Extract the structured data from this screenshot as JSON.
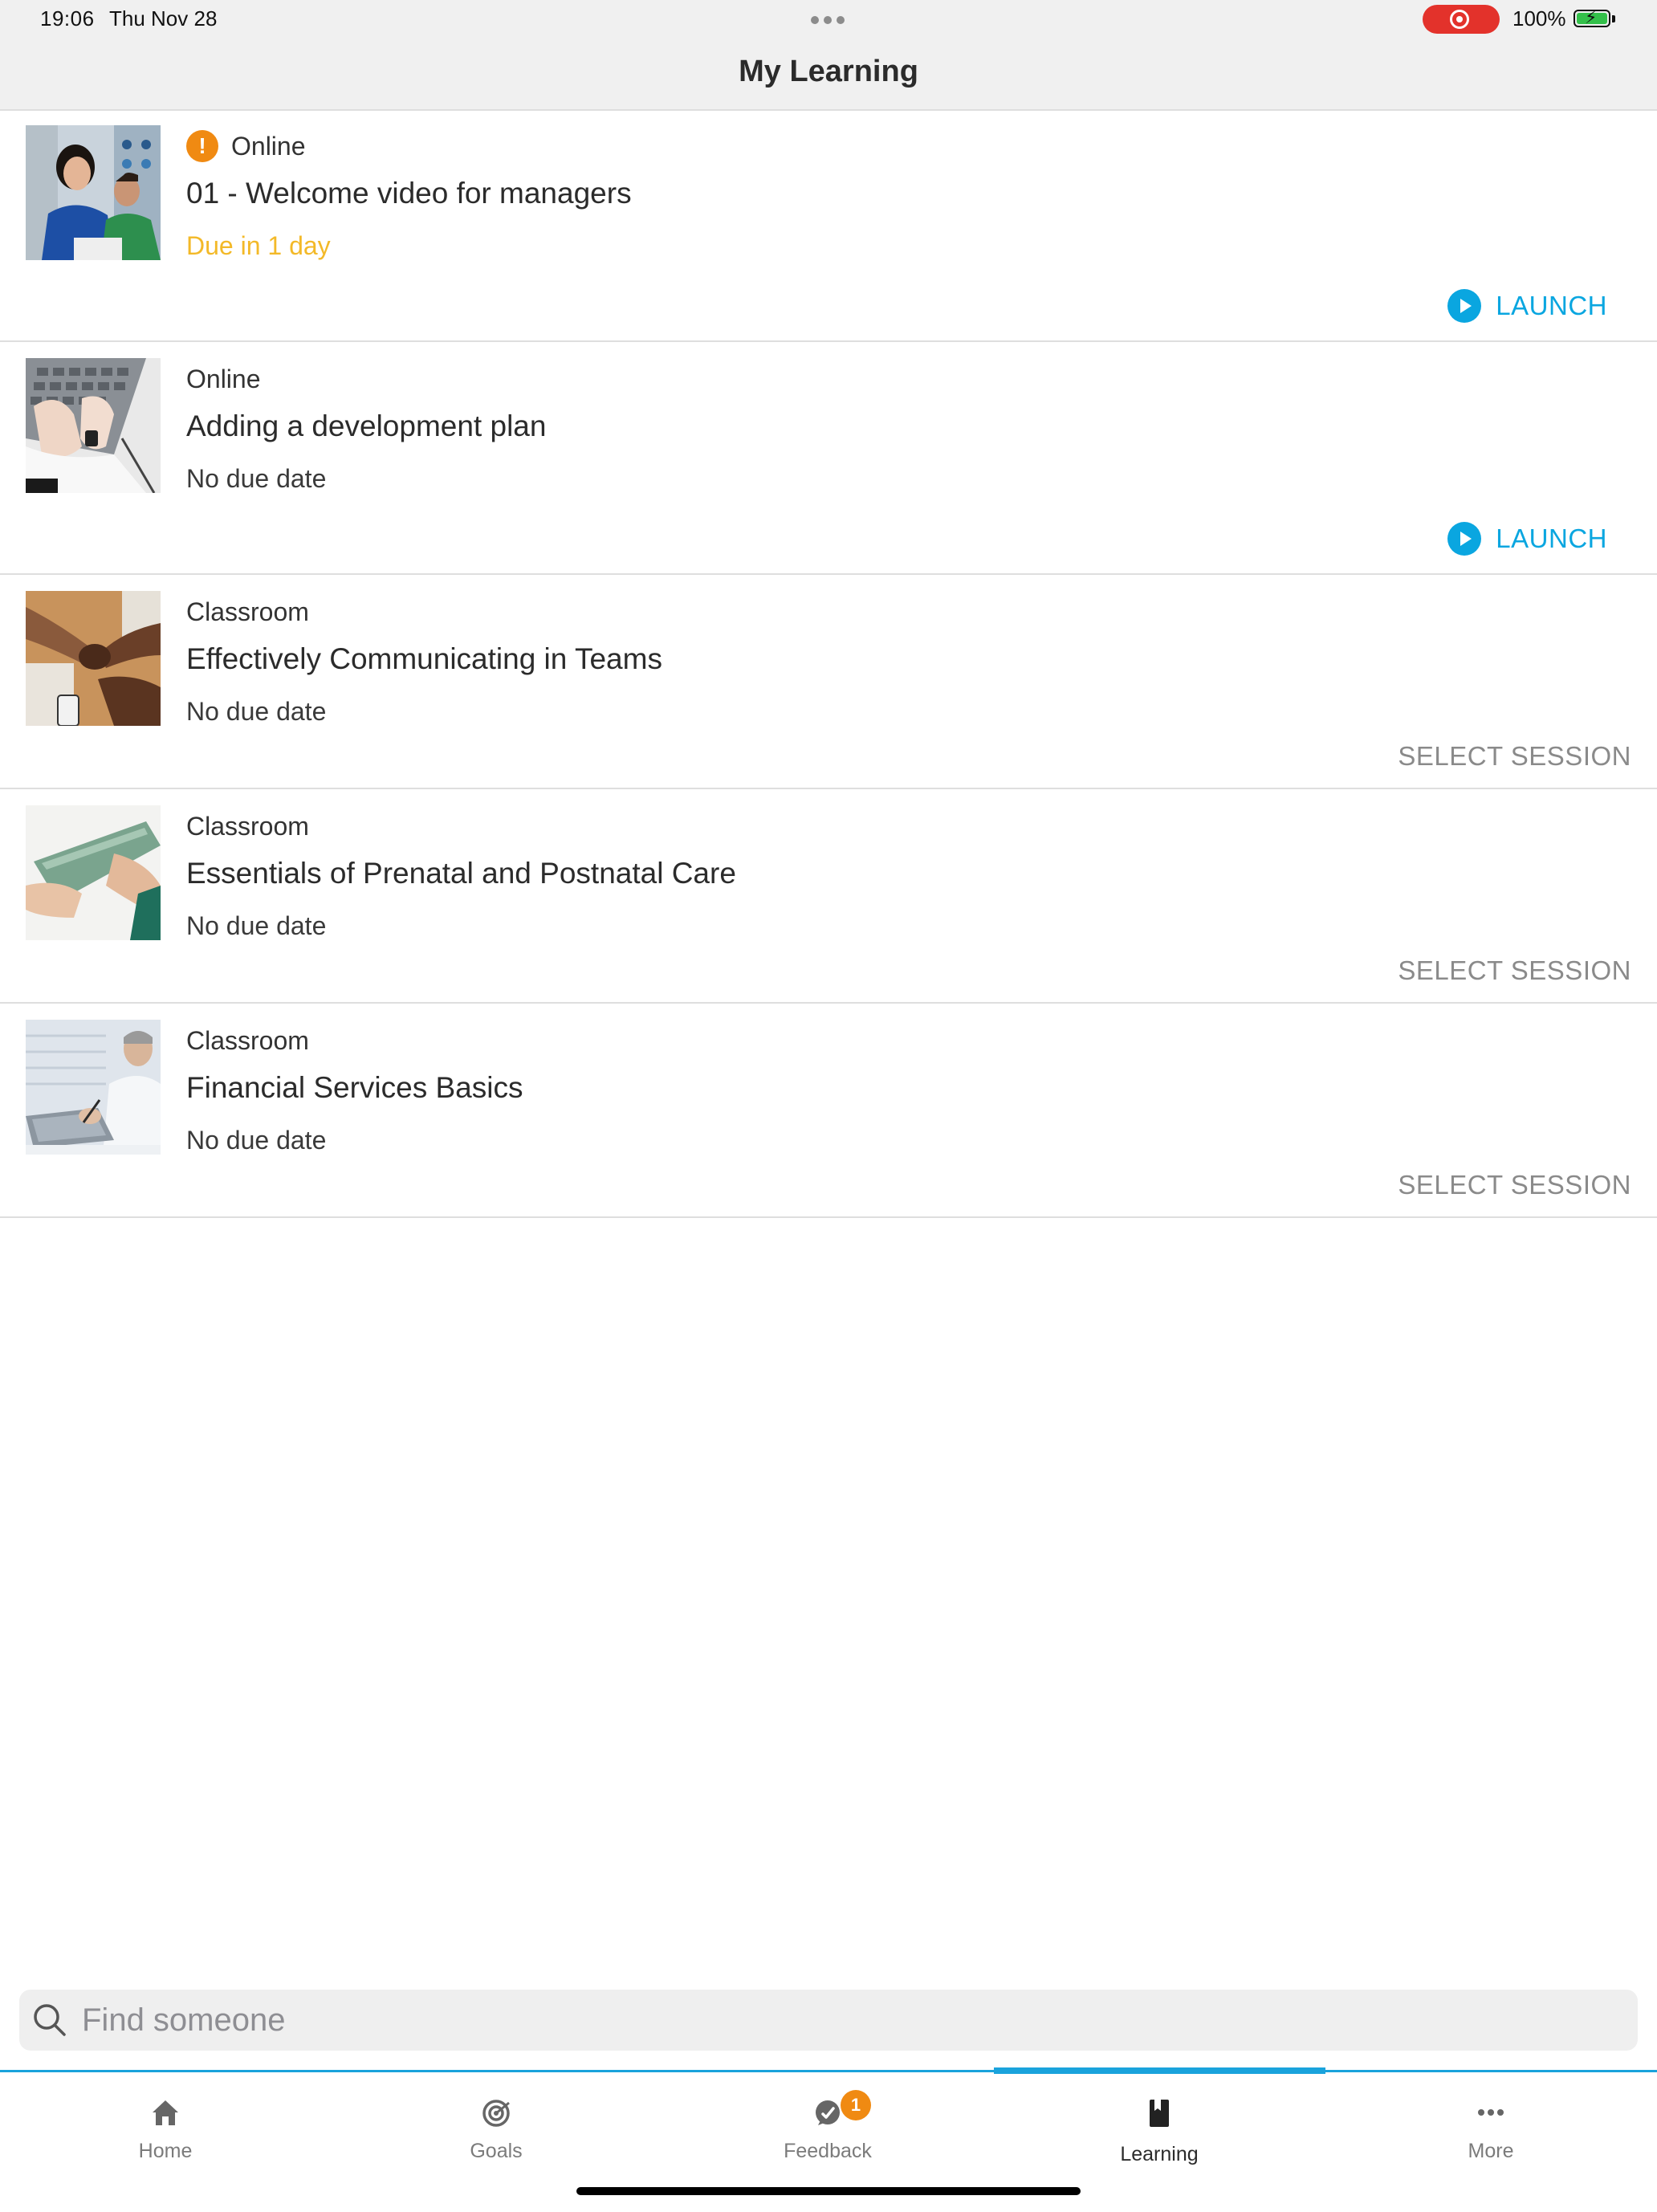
{
  "status_bar": {
    "time": "19:06",
    "date": "Thu Nov 28",
    "battery": "100%"
  },
  "header": {
    "title": "My Learning"
  },
  "courses": [
    {
      "type": "Online",
      "title": "01 - Welcome video for managers",
      "due": "Due in 1 day",
      "action": "LAUNCH",
      "overdue_warning": true,
      "thumbnail": "two-people-at-laptop"
    },
    {
      "type": "Online",
      "title": "Adding a development plan",
      "due": "No due date",
      "action": "LAUNCH",
      "overdue_warning": false,
      "thumbnail": "hands-on-laptop-keyboard"
    },
    {
      "type": "Classroom",
      "title": "Effectively Communicating in Teams",
      "due": "No due date",
      "action": "SELECT SESSION",
      "thumbnail": "fist-bump-over-desk"
    },
    {
      "type": "Classroom",
      "title": "Essentials of Prenatal and Postnatal Care",
      "due": "No due date",
      "action": "SELECT SESSION",
      "thumbnail": "hands-holding-clipboard"
    },
    {
      "type": "Classroom",
      "title": "Financial Services Basics",
      "due": "No due date",
      "action": "SELECT SESSION",
      "thumbnail": "man-writing-at-laptop"
    }
  ],
  "search": {
    "placeholder": "Find someone",
    "value": ""
  },
  "tabs": [
    {
      "label": "Home",
      "icon": "home-icon",
      "active": false
    },
    {
      "label": "Goals",
      "icon": "target-icon",
      "active": false
    },
    {
      "label": "Feedback",
      "icon": "feedback-icon",
      "active": false,
      "badge": "1"
    },
    {
      "label": "Learning",
      "icon": "book-icon",
      "active": true
    },
    {
      "label": "More",
      "icon": "more-icon",
      "active": false
    }
  ],
  "colors": {
    "accent": "#1aa3dc",
    "warning": "#f08a12",
    "due_warning": "#f3b928",
    "muted": "#8a8a8a"
  }
}
